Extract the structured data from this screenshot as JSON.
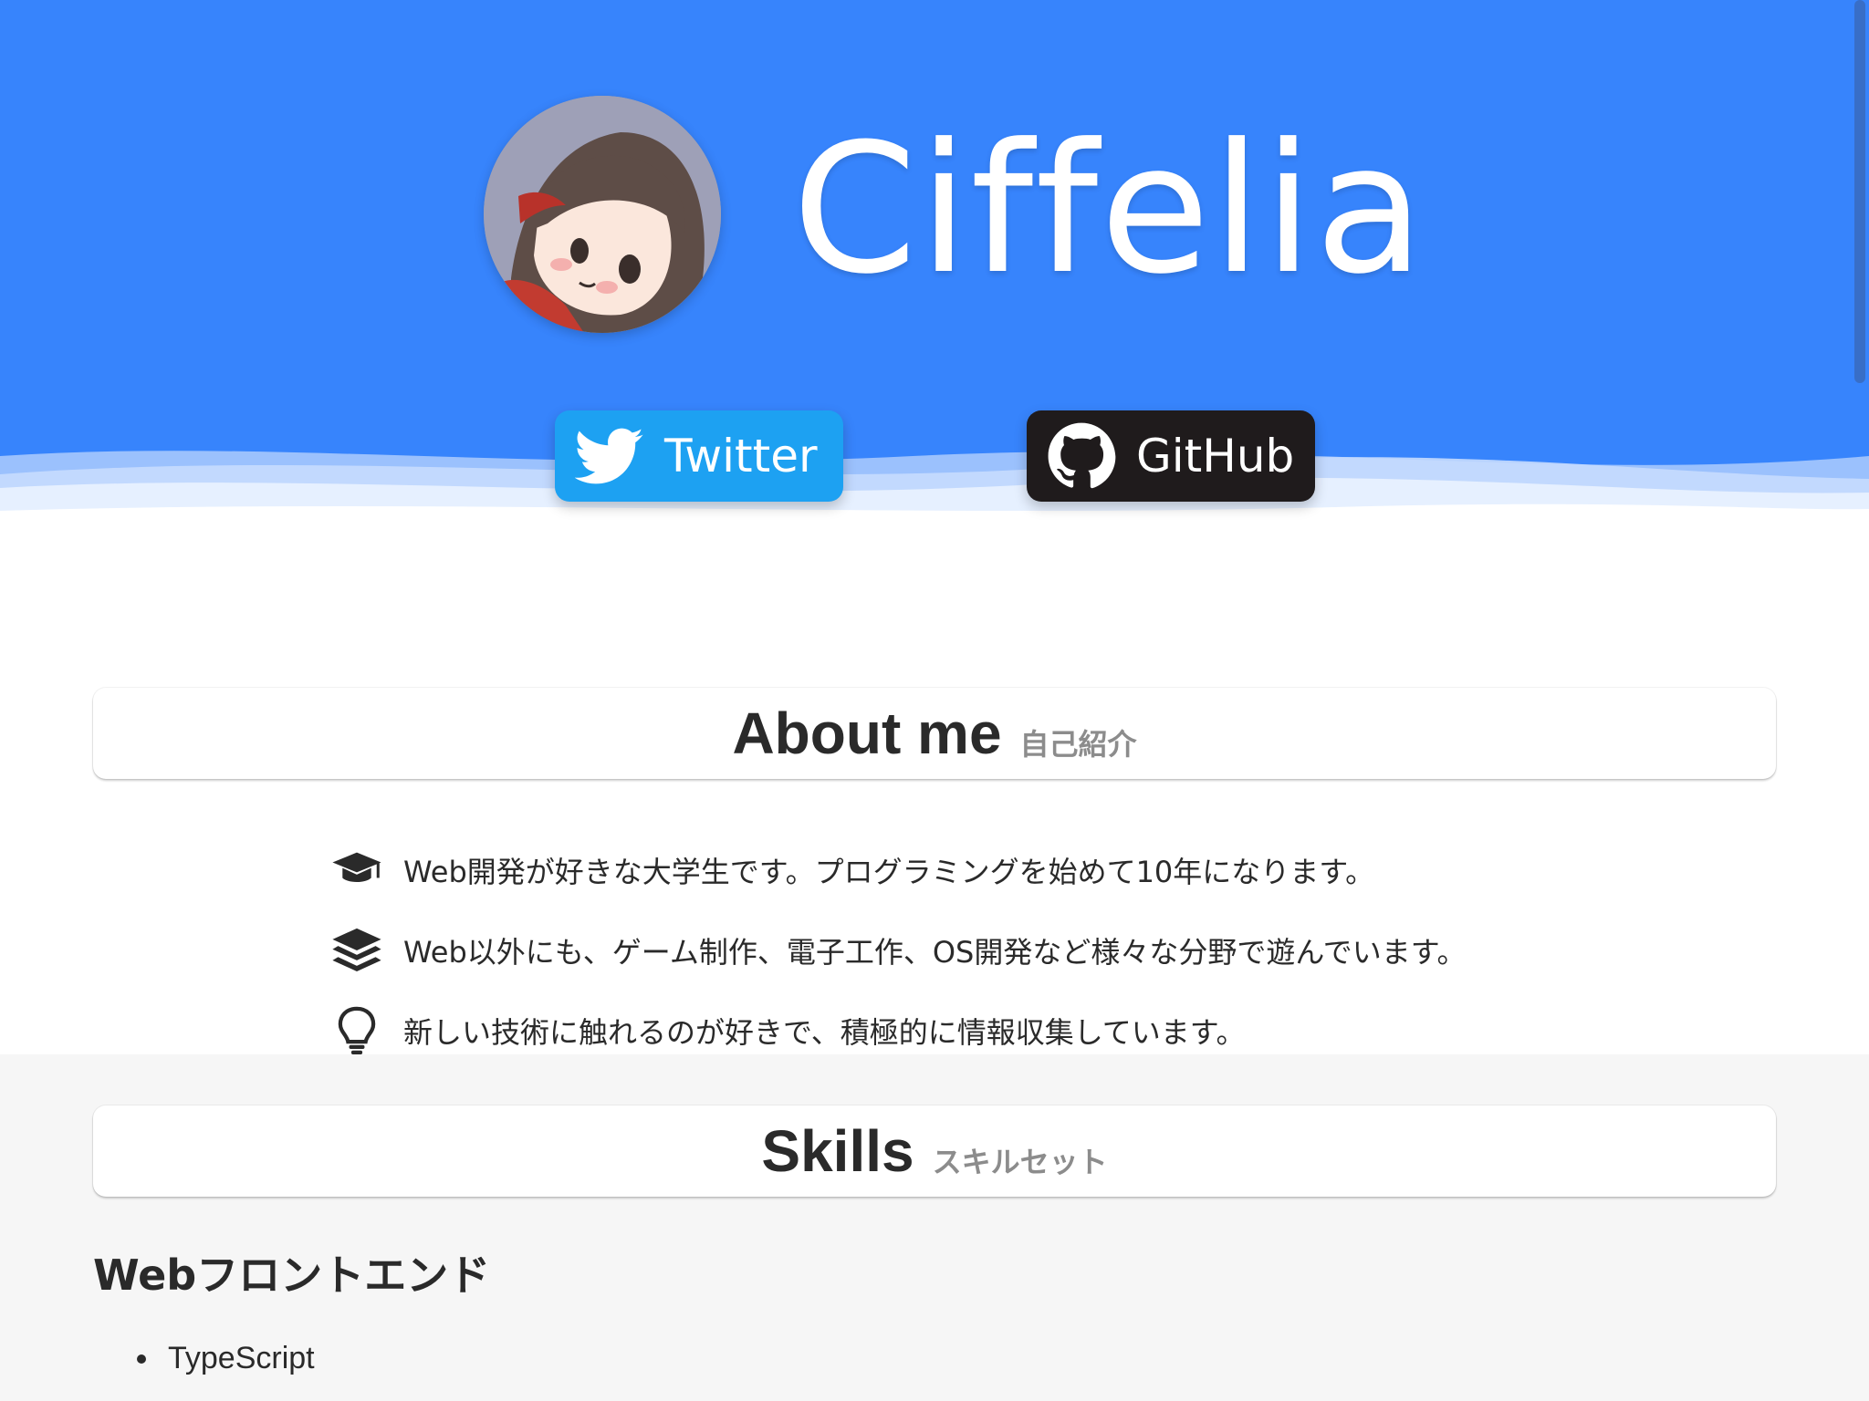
{
  "site": {
    "title": "Ciffelia",
    "avatar_icon": "avatar-illustration"
  },
  "social": {
    "twitter_label": "Twitter",
    "twitter_icon": "twitter-bird-icon",
    "twitter_color": "#1da1f2",
    "github_label": "GitHub",
    "github_icon": "github-octocat-icon",
    "github_color": "#1f1b1c"
  },
  "colors": {
    "hero_background": "#3784fc",
    "skills_background": "#f6f6f6"
  },
  "about": {
    "title": "About me",
    "subtitle": "自己紹介",
    "items": [
      {
        "icon": "graduation-cap-icon",
        "text": "Web開発が好きな大学生です。プログラミングを始めて10年になります。"
      },
      {
        "icon": "layers-icon",
        "text": "Web以外にも、ゲーム制作、電子工作、OS開発など様々な分野で遊んでいます。"
      },
      {
        "icon": "lightbulb-icon",
        "text": "新しい技術に触れるのが好きで、積極的に情報収集しています。"
      }
    ]
  },
  "skills": {
    "title": "Skills",
    "subtitle": "スキルセット",
    "categories": [
      {
        "name": "Webフロントエンド",
        "items": [
          "TypeScript"
        ]
      }
    ]
  }
}
